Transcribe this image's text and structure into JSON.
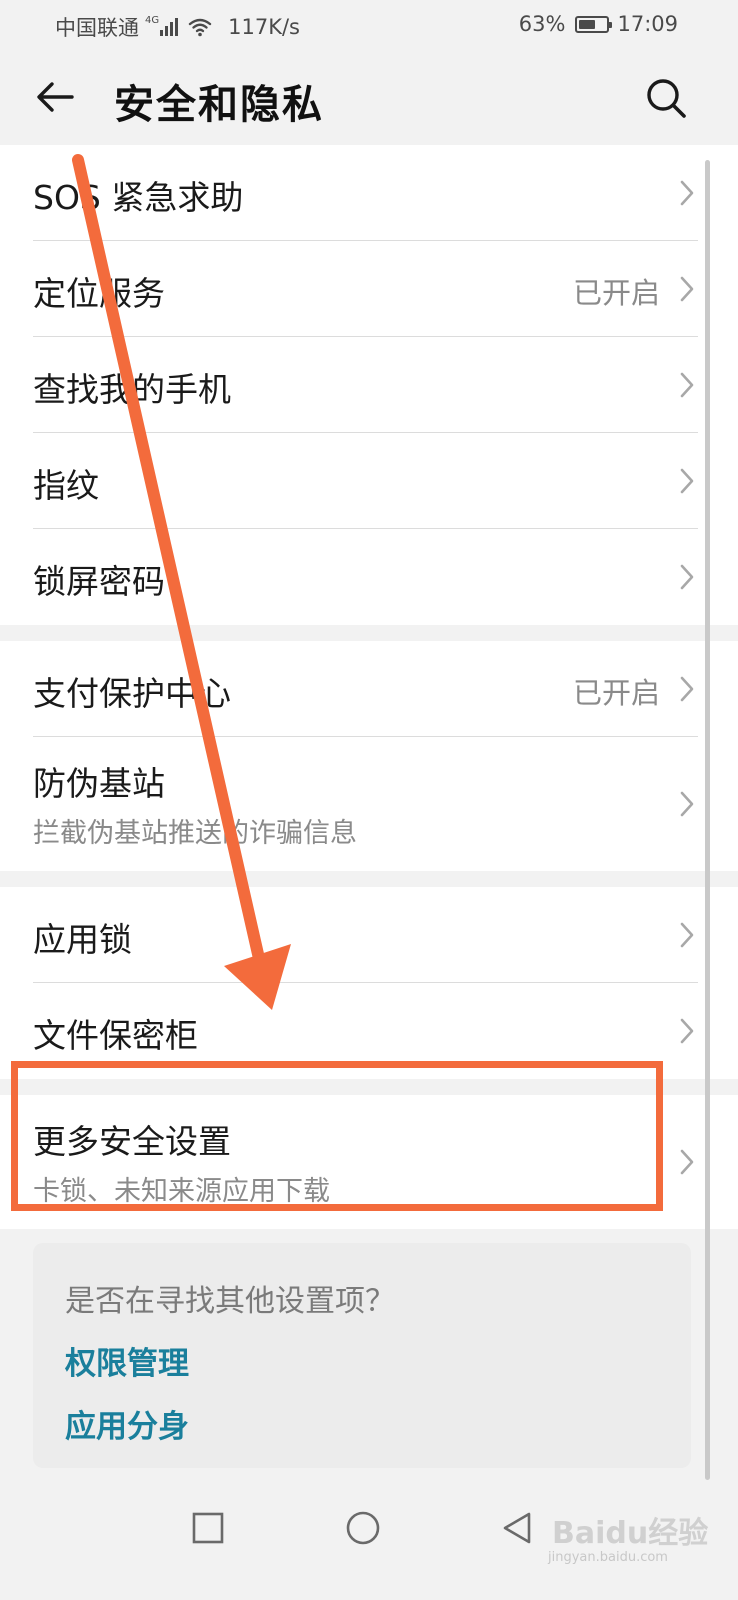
{
  "status_bar": {
    "carrier": "中国联通",
    "network_tag": "4G",
    "speed": "117K/s",
    "battery_percent_label": "63%",
    "battery_level": 0.63,
    "time": "17:09"
  },
  "header": {
    "title": "安全和隐私",
    "back_icon": "arrow-left-icon",
    "search_icon": "search-icon"
  },
  "groups": [
    {
      "items": [
        {
          "title": "SOS 紧急求助",
          "value": "",
          "subtitle": ""
        },
        {
          "title": "定位服务",
          "value": "已开启",
          "subtitle": ""
        },
        {
          "title": "查找我的手机",
          "value": "",
          "subtitle": ""
        },
        {
          "title": "指纹",
          "value": "",
          "subtitle": ""
        },
        {
          "title": "锁屏密码",
          "value": "",
          "subtitle": ""
        }
      ]
    },
    {
      "items": [
        {
          "title": "支付保护中心",
          "value": "已开启",
          "subtitle": ""
        },
        {
          "title": "防伪基站",
          "value": "",
          "subtitle": "拦截伪基站推送的诈骗信息"
        }
      ]
    },
    {
      "items": [
        {
          "title": "应用锁",
          "value": "",
          "subtitle": ""
        },
        {
          "title": "文件保密柜",
          "value": "",
          "subtitle": ""
        }
      ]
    },
    {
      "items": [
        {
          "title": "更多安全设置",
          "value": "",
          "subtitle": "卡锁、未知来源应用下载"
        }
      ]
    }
  ],
  "suggestions": {
    "title": "是否在寻找其他设置项？",
    "links": [
      "权限管理",
      "应用分身"
    ]
  },
  "annotation": {
    "arrow_color": "#f36b3c",
    "box_color": "#f36b3c"
  },
  "colors": {
    "link": "#1a7f9c",
    "secondary_text": "#8a8a8a",
    "background": "#f2f2f2"
  },
  "watermark": {
    "brand": "Baidu经验",
    "url": "jingyan.baidu.com"
  }
}
